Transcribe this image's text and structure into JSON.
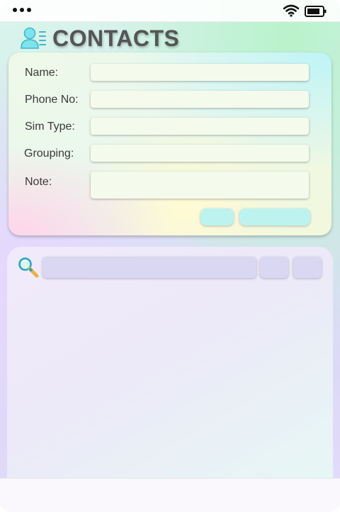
{
  "header": {
    "title": "CONTACTS",
    "icon": "contact-list-icon"
  },
  "status_bar": {
    "icons": [
      "more-dots-icon",
      "wifi-icon",
      "battery-icon"
    ]
  },
  "form": {
    "name": {
      "label": "Name:",
      "value": ""
    },
    "phone": {
      "label": "Phone No:",
      "value": ""
    },
    "sim_type": {
      "label": "Sim Type:",
      "value": ""
    },
    "grouping": {
      "label": "Grouping:",
      "value": ""
    },
    "note": {
      "label": "Note:",
      "value": ""
    },
    "small_button_label": "",
    "wide_button_label": ""
  },
  "list": {
    "search_icon": "magnifier-icon",
    "search_value": "",
    "button1_label": "",
    "button2_label": ""
  },
  "colors": {
    "title": "#555555",
    "form_button": "#bdf3ef",
    "search_bar": "#d9d7f2"
  }
}
